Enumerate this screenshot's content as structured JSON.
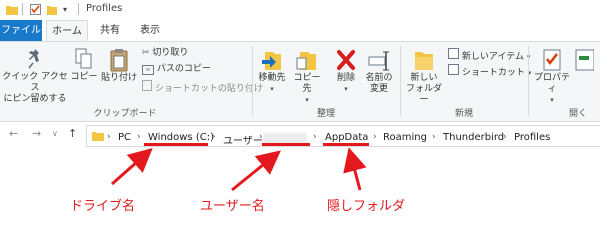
{
  "window": {
    "title": "Profiles"
  },
  "tabs": {
    "file": "ファイル",
    "home": "ホーム",
    "share": "共有",
    "view": "表示"
  },
  "ribbon": {
    "clipboard": {
      "pin_line1": "クイック アクセス",
      "pin_line2": "にピン留めする",
      "copy": "コピー",
      "paste": "貼り付け",
      "cut": "切り取り",
      "copy_path": "パスのコピー",
      "paste_shortcut": "ショートカットの貼り付け",
      "label": "クリップボード"
    },
    "organize": {
      "move_to": "移動先",
      "copy_to": "コピー先",
      "delete": "削除",
      "rename_line1": "名前の",
      "rename_line2": "変更",
      "label": "整理"
    },
    "new": {
      "new_folder_line1": "新しい",
      "new_folder_line2": "フォルダー",
      "new_item": "新しいアイテム",
      "shortcut": "ショートカット",
      "label": "新規"
    },
    "open": {
      "properties": "プロパティ",
      "label": "開く"
    }
  },
  "address_bar": {
    "crumbs": [
      "PC",
      "Windows (C:)",
      "ユーザー",
      "AppData",
      "Roaming",
      "Thunderbird",
      "Profiles"
    ]
  },
  "annotations": {
    "drive_name": "ドライブ名",
    "user_name": "ユーザー名",
    "hidden_folder": "隠しフォルダ"
  },
  "colors": {
    "file_tab": "#1979ca",
    "annotation_red": "#e4191d",
    "folder_yellow": "#f4c542"
  }
}
